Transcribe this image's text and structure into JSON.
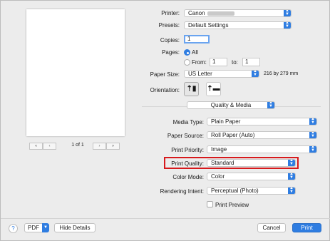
{
  "printer": {
    "label": "Printer:",
    "value": "Canon"
  },
  "presets": {
    "label": "Presets:",
    "value": "Default Settings"
  },
  "copies": {
    "label": "Copies:",
    "value": "1"
  },
  "pages": {
    "label": "Pages:",
    "all_label": "All",
    "from_label": "From:",
    "from_value": "1",
    "to_label": "to:",
    "to_value": "1"
  },
  "paper_size": {
    "label": "Paper Size:",
    "value": "US Letter",
    "dimensions": "216 by 279 mm"
  },
  "orientation": {
    "label": "Orientation:"
  },
  "section": {
    "value": "Quality & Media"
  },
  "media_type": {
    "label": "Media Type:",
    "value": "Plain Paper"
  },
  "paper_source": {
    "label": "Paper Source:",
    "value": "Roll Paper (Auto)"
  },
  "print_priority": {
    "label": "Print Priority:",
    "value": "Image"
  },
  "print_quality": {
    "label": "Print Quality:",
    "value": "Standard"
  },
  "color_mode": {
    "label": "Color Mode:",
    "value": "Color"
  },
  "rendering_intent": {
    "label": "Rendering Intent:",
    "value": "Perceptual (Photo)"
  },
  "print_preview": {
    "label": "Print Preview"
  },
  "preview_pager": {
    "page_text": "1 of 1"
  },
  "footer": {
    "help": "?",
    "pdf": "PDF",
    "hide_details": "Hide Details",
    "cancel": "Cancel",
    "print": "Print"
  },
  "icons": {
    "first": "«",
    "prev": "‹",
    "next": "›",
    "last": "»",
    "stepper": "chevron-updown-icon"
  },
  "colors": {
    "accent": "#2f7de1",
    "highlight": "#d7191c"
  }
}
